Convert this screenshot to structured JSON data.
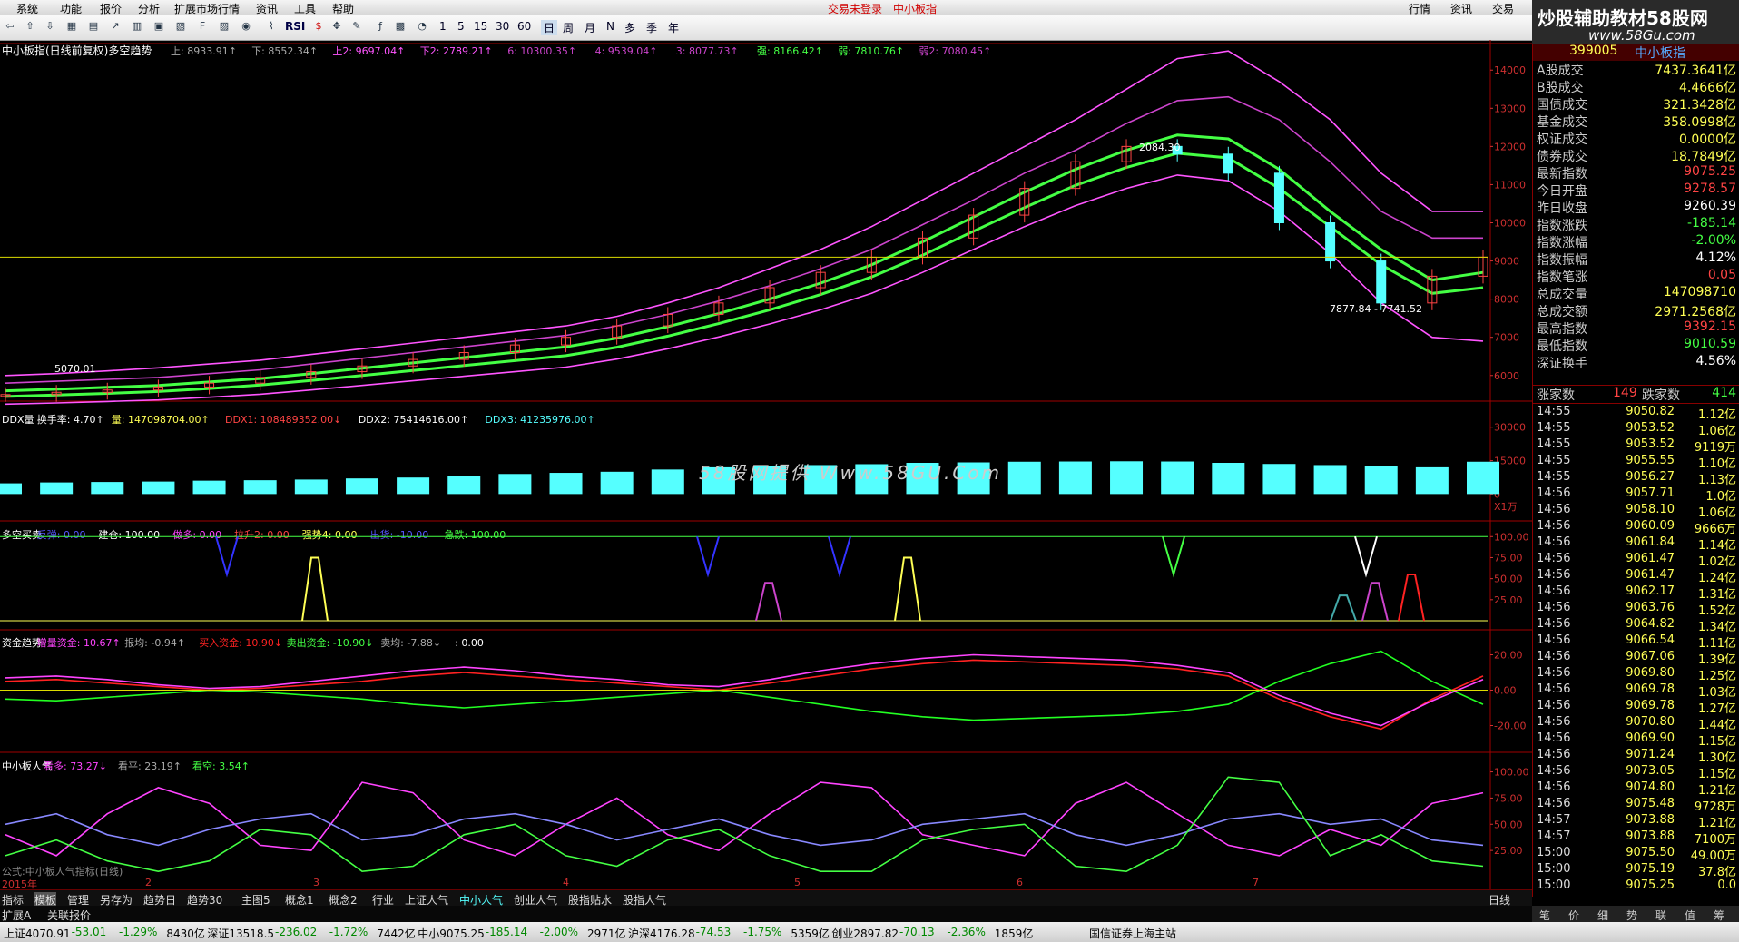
{
  "menu": {
    "items": [
      "系统",
      "功能",
      "报价",
      "分析",
      "扩展市场行情",
      "资讯",
      "工具",
      "帮助"
    ],
    "center": [
      "交易未登录",
      "中小板指"
    ],
    "right": [
      "行情",
      "资讯",
      "交易"
    ]
  },
  "toolbar": {
    "periods": [
      "1",
      "5",
      "15",
      "30",
      "60",
      "日",
      "周",
      "月",
      "N",
      "多",
      "季",
      "年"
    ],
    "rsi_label": "RSI"
  },
  "logo": {
    "line1": "炒股辅助教材58股网",
    "line2": "www.58Gu.com"
  },
  "watermark": "58股网提供 Www.58GU.Com",
  "main_panel": {
    "header_title": "中小板指(日线前复权)多空趋势",
    "header_fields": [
      {
        "text": "上: 8933.91↑",
        "color": "#aaaaaa"
      },
      {
        "text": "下: 8552.34↑",
        "color": "#aaaaaa"
      },
      {
        "text": "上2: 9697.04↑",
        "color": "#ff55ff"
      },
      {
        "text": "下2: 2789.21↑",
        "color": "#ff55ff"
      },
      {
        "text": "6: 10300.35↑",
        "color": "#cc44cc"
      },
      {
        "text": "4: 9539.04↑",
        "color": "#cc44cc"
      },
      {
        "text": "3: 8077.73↑",
        "color": "#cc44cc"
      },
      {
        "text": "强: 8166.42↑",
        "color": "#44ff44"
      },
      {
        "text": "弱: 7810.76↑",
        "color": "#44ff44"
      },
      {
        "text": "弱2: 7080.45↑",
        "color": "#cc44cc"
      }
    ],
    "annotations": {
      "high": "2084.30",
      "range": "7877.84 - 7741.52",
      "start": "5070.01"
    }
  },
  "chart_data": [
    {
      "type": "line",
      "title": "中小板指(日线前复权)多空趋势",
      "ylabel": "",
      "y_ticks": [
        14000,
        13000,
        12000,
        11000,
        10000,
        9000,
        8000,
        7000,
        6000
      ],
      "ylim": [
        5400,
        14600
      ],
      "x_labels": [
        "2015年",
        "2",
        "3",
        "4",
        "5",
        "6",
        "7"
      ],
      "series": [
        {
          "name": "上2",
          "color": "#ff55ff",
          "values": [
            6000,
            6050,
            6120,
            6200,
            6300,
            6400,
            6550,
            6700,
            6850,
            7000,
            7150,
            7300,
            7550,
            7900,
            8300,
            8800,
            9300,
            9900,
            10600,
            11300,
            12000,
            12700,
            13500,
            14300,
            14500,
            13700,
            12700,
            11300,
            10300,
            10300
          ]
        },
        {
          "name": "上",
          "color": "#cc44cc",
          "values": [
            5800,
            5850,
            5900,
            5950,
            6050,
            6150,
            6300,
            6450,
            6600,
            6750,
            6900,
            7050,
            7300,
            7600,
            7950,
            8350,
            8800,
            9300,
            9950,
            10600,
            11300,
            11900,
            12600,
            13200,
            13300,
            12700,
            11600,
            10300,
            9600,
            9600
          ]
        },
        {
          "name": "强",
          "color": "#44ff44",
          "values": [
            5600,
            5640,
            5690,
            5740,
            5830,
            5920,
            6050,
            6190,
            6330,
            6470,
            6610,
            6750,
            6980,
            7280,
            7620,
            8000,
            8420,
            8900,
            9500,
            10150,
            10800,
            11400,
            11900,
            12300,
            12200,
            11400,
            10300,
            9300,
            8500,
            8700
          ]
        },
        {
          "name": "弱",
          "color": "#44ff44",
          "values": [
            5450,
            5490,
            5530,
            5580,
            5660,
            5750,
            5870,
            6000,
            6130,
            6260,
            6390,
            6520,
            6740,
            7030,
            7360,
            7720,
            8120,
            8580,
            9150,
            9780,
            10400,
            10980,
            11450,
            11820,
            11700,
            10900,
            9900,
            8900,
            8150,
            8300
          ]
        },
        {
          "name": "下2",
          "color": "#ff55ff",
          "values": [
            5250,
            5280,
            5320,
            5360,
            5430,
            5510,
            5620,
            5740,
            5860,
            5980,
            6100,
            6220,
            6430,
            6700,
            7010,
            7350,
            7720,
            8150,
            8700,
            9300,
            9900,
            10450,
            10900,
            11250,
            11100,
            10300,
            9200,
            7900,
            7000,
            6900
          ]
        }
      ],
      "candles_close": [
        5500,
        5560,
        5620,
        5700,
        5800,
        5950,
        6100,
        6250,
        6420,
        6600,
        6800,
        7000,
        7300,
        7600,
        7900,
        8300,
        8700,
        9100,
        9600,
        10200,
        10900,
        11600,
        12000,
        11800,
        11300,
        10000,
        9000,
        7900,
        8600,
        9100
      ]
    },
    {
      "type": "bar",
      "title": "DDX量",
      "ylabel": "",
      "y_ticks": [
        30000,
        15000,
        0
      ],
      "ylim": [
        -8000,
        36000
      ],
      "series": [
        {
          "name": "量",
          "color": "#55ffff",
          "values": [
            4800,
            5200,
            5400,
            5600,
            6000,
            6200,
            6500,
            7000,
            7400,
            8000,
            9000,
            9500,
            10000,
            11000,
            12000,
            12500,
            13000,
            13400,
            14000,
            14200,
            14500,
            14600,
            14700,
            14600,
            14000,
            13500,
            13000,
            12500,
            12000,
            14500
          ]
        }
      ]
    },
    {
      "type": "line",
      "title": "多空买卖",
      "ylabel": "",
      "y_ticks": [
        100,
        75,
        50,
        25
      ],
      "ylim": [
        0,
        110
      ]
    },
    {
      "type": "line",
      "title": "资金趋势",
      "ylabel": "",
      "y_ticks": [
        20,
        0,
        -20
      ],
      "ylim": [
        -30,
        30
      ],
      "series": [
        {
          "name": "买入资金",
          "color": "#ff2222",
          "values": [
            5,
            6,
            4,
            2,
            0,
            1,
            3,
            5,
            8,
            10,
            8,
            6,
            4,
            2,
            0,
            4,
            8,
            12,
            15,
            17,
            16,
            15,
            14,
            12,
            8,
            -5,
            -15,
            -22,
            -5,
            8
          ]
        },
        {
          "name": "卖出资金",
          "color": "#22ff22",
          "values": [
            -5,
            -6,
            -4,
            -2,
            0,
            -1,
            -3,
            -5,
            -8,
            -10,
            -8,
            -6,
            -4,
            -2,
            0,
            -4,
            -8,
            -12,
            -15,
            -17,
            -16,
            -15,
            -14,
            -12,
            -8,
            5,
            15,
            22,
            5,
            -8
          ]
        },
        {
          "name": "增量资金",
          "color": "#ff44ff",
          "values": [
            7,
            8,
            6,
            3,
            1,
            2,
            5,
            8,
            11,
            13,
            11,
            8,
            6,
            3,
            2,
            6,
            11,
            15,
            18,
            20,
            19,
            18,
            17,
            14,
            10,
            -3,
            -13,
            -20,
            -6,
            6
          ]
        }
      ]
    },
    {
      "type": "line",
      "title": "中小板人气",
      "ylabel": "",
      "y_ticks": [
        100,
        75,
        50,
        25
      ],
      "ylim": [
        0,
        110
      ],
      "series": [
        {
          "name": "看多",
          "color": "#ff44ff",
          "values": [
            40,
            20,
            60,
            85,
            70,
            30,
            25,
            90,
            80,
            35,
            20,
            50,
            75,
            40,
            25,
            60,
            90,
            85,
            40,
            30,
            20,
            70,
            90,
            60,
            30,
            20,
            45,
            30,
            70,
            80
          ]
        },
        {
          "name": "看平",
          "color": "#8888ff",
          "values": [
            50,
            60,
            40,
            30,
            45,
            55,
            60,
            35,
            40,
            55,
            60,
            50,
            35,
            45,
            55,
            40,
            30,
            35,
            50,
            55,
            60,
            40,
            30,
            40,
            55,
            60,
            50,
            55,
            35,
            30
          ]
        },
        {
          "name": "看空",
          "color": "#44ff44",
          "values": [
            20,
            35,
            15,
            5,
            15,
            45,
            40,
            5,
            10,
            40,
            50,
            20,
            10,
            35,
            45,
            20,
            5,
            5,
            35,
            45,
            50,
            10,
            5,
            30,
            95,
            90,
            20,
            40,
            15,
            10
          ]
        }
      ]
    }
  ],
  "ddx_header": [
    {
      "text": "DDX量",
      "color": "#ffffff"
    },
    {
      "text": "换手率: 4.70↑",
      "color": "#ffffff"
    },
    {
      "text": "量: 147098704.00↑",
      "color": "#ffff55"
    },
    {
      "text": "DDX1: 108489352.00↓",
      "color": "#ff4444"
    },
    {
      "text": "DDX2: 75414616.00↑",
      "color": "#ffffff"
    },
    {
      "text": "DDX3: 41235976.00↑",
      "color": "#55ffff"
    }
  ],
  "duokong_header": [
    {
      "text": "多空买卖",
      "color": "#ffffff"
    },
    {
      "text": "反弹: 0.00",
      "color": "#5555ff"
    },
    {
      "text": "建仓: 100.00",
      "color": "#ffffff"
    },
    {
      "text": "做多: 0.00",
      "color": "#ff44ff"
    },
    {
      "text": "拉升2: 0.00",
      "color": "#ff4444"
    },
    {
      "text": "强势4: 0.00",
      "color": "#ffff55"
    },
    {
      "text": "出货: -10.00",
      "color": "#5555ff"
    },
    {
      "text": "急跌: 100.00",
      "color": "#44ff44"
    }
  ],
  "fund_header": [
    {
      "text": "资金趋势",
      "color": "#ffffff"
    },
    {
      "text": "增量资金: 10.67↑",
      "color": "#ff44ff"
    },
    {
      "text": "报均: -0.94↑",
      "color": "#aaaaaa"
    },
    {
      "text": "买入资金: 10.90↓",
      "color": "#ff2222"
    },
    {
      "text": "卖出资金: -10.90↓",
      "color": "#44ff44"
    },
    {
      "text": "卖均: -7.88↓",
      "color": "#aaaaaa"
    },
    {
      "text": ": 0.00",
      "color": "#ffffff"
    }
  ],
  "renqi_header": [
    {
      "text": "中小板人气",
      "color": "#ffffff"
    },
    {
      "text": "看多: 73.27↓",
      "color": "#ff44ff"
    },
    {
      "text": "看平: 23.19↑",
      "color": "#aaaaaa"
    },
    {
      "text": "看空: 3.54↑",
      "color": "#44ff44"
    }
  ],
  "renqi_note": "公式:中小板人气指标(日线)",
  "unit_label": "X1万",
  "timeline": {
    "labels": [
      "2015年",
      "2",
      "3",
      "4",
      "5",
      "6",
      "7"
    ]
  },
  "tabs": [
    "指标",
    "模板",
    "管理",
    "另存为",
    "趋势日",
    "趋势30",
    "主图5",
    "概念1",
    "概念2",
    "行业",
    "上证人气",
    "中小人气",
    "创业人气",
    "股指贴水",
    "股指人气"
  ],
  "tabs2": [
    "扩展A",
    "关联报价"
  ],
  "period_label": "日线",
  "side": {
    "code": "399005",
    "name": "中小板指",
    "rows": [
      {
        "label": "A股成交",
        "value": "7437.3641亿",
        "color": "#ffff55"
      },
      {
        "label": "B股成交",
        "value": "4.4666亿",
        "color": "#ffff55"
      },
      {
        "label": "国债成交",
        "value": "321.3428亿",
        "color": "#ffff55"
      },
      {
        "label": "基金成交",
        "value": "358.0998亿",
        "color": "#ffff55"
      },
      {
        "label": "权证成交",
        "value": "0.0000亿",
        "color": "#ffff55"
      },
      {
        "label": "债券成交",
        "value": "18.7849亿",
        "color": "#ffff55"
      },
      {
        "label": "最新指数",
        "value": "9075.25",
        "color": "#ff4444"
      },
      {
        "label": "今日开盘",
        "value": "9278.57",
        "color": "#ff4444"
      },
      {
        "label": "昨日收盘",
        "value": "9260.39",
        "color": "#ffffff"
      },
      {
        "label": "指数涨跌",
        "value": "-185.14",
        "color": "#44ff44"
      },
      {
        "label": "指数涨幅",
        "value": "-2.00%",
        "color": "#44ff44"
      },
      {
        "label": "指数振幅",
        "value": "4.12%",
        "color": "#ffffff"
      },
      {
        "label": "指数笔涨",
        "value": "0.05",
        "color": "#ff4444"
      },
      {
        "label": "总成交量",
        "value": "147098710",
        "color": "#ffff55"
      },
      {
        "label": "总成交额",
        "value": "2971.2568亿",
        "color": "#ffff55"
      },
      {
        "label": "最高指数",
        "value": "9392.15",
        "color": "#ff4444"
      },
      {
        "label": "最低指数",
        "value": "9010.59",
        "color": "#44ff44"
      },
      {
        "label": "深证换手",
        "value": "4.56%",
        "color": "#ffffff"
      }
    ],
    "up_label": "涨家数",
    "up_value": "149",
    "down_label": "跌家数",
    "down_value": "414",
    "ticks": [
      {
        "t": "14:55",
        "p": "9050.82",
        "v": "1.12亿"
      },
      {
        "t": "14:55",
        "p": "9053.52",
        "v": "1.06亿"
      },
      {
        "t": "14:55",
        "p": "9053.52",
        "v": "9119万"
      },
      {
        "t": "14:55",
        "p": "9055.55",
        "v": "1.10亿"
      },
      {
        "t": "14:55",
        "p": "9056.27",
        "v": "1.13亿"
      },
      {
        "t": "14:56",
        "p": "9057.71",
        "v": "1.0亿"
      },
      {
        "t": "14:56",
        "p": "9058.10",
        "v": "1.06亿"
      },
      {
        "t": "14:56",
        "p": "9060.09",
        "v": "9666万"
      },
      {
        "t": "14:56",
        "p": "9061.84",
        "v": "1.14亿"
      },
      {
        "t": "14:56",
        "p": "9061.47",
        "v": "1.02亿"
      },
      {
        "t": "14:56",
        "p": "9061.47",
        "v": "1.24亿"
      },
      {
        "t": "14:56",
        "p": "9062.17",
        "v": "1.31亿"
      },
      {
        "t": "14:56",
        "p": "9063.76",
        "v": "1.52亿"
      },
      {
        "t": "14:56",
        "p": "9064.82",
        "v": "1.34亿"
      },
      {
        "t": "14:56",
        "p": "9066.54",
        "v": "1.11亿"
      },
      {
        "t": "14:56",
        "p": "9067.06",
        "v": "1.39亿"
      },
      {
        "t": "14:56",
        "p": "9069.80",
        "v": "1.25亿"
      },
      {
        "t": "14:56",
        "p": "9069.78",
        "v": "1.03亿"
      },
      {
        "t": "14:56",
        "p": "9069.78",
        "v": "1.27亿"
      },
      {
        "t": "14:56",
        "p": "9070.80",
        "v": "1.44亿"
      },
      {
        "t": "14:56",
        "p": "9069.90",
        "v": "1.15亿"
      },
      {
        "t": "14:56",
        "p": "9071.24",
        "v": "1.30亿"
      },
      {
        "t": "14:56",
        "p": "9073.05",
        "v": "1.15亿"
      },
      {
        "t": "14:56",
        "p": "9074.80",
        "v": "1.21亿"
      },
      {
        "t": "14:56",
        "p": "9075.48",
        "v": "9728万"
      },
      {
        "t": "14:57",
        "p": "9073.88",
        "v": "1.21亿"
      },
      {
        "t": "14:57",
        "p": "9073.88",
        "v": "7100万"
      },
      {
        "t": "15:00",
        "p": "9075.50",
        "v": "49.00万"
      },
      {
        "t": "15:00",
        "p": "9075.19",
        "v": "37.8亿"
      },
      {
        "t": "15:00",
        "p": "9075.25",
        "v": "0.0"
      }
    ],
    "bottom_tabs": [
      "笔",
      "价",
      "细",
      "势",
      "联",
      "值",
      "筹"
    ]
  },
  "statusbar": {
    "segments": [
      {
        "text": "上证4070.91",
        "color": "#000000"
      },
      {
        "text": "-53.01",
        "color": "#008800"
      },
      {
        "text": "-1.29%",
        "color": "#008800"
      },
      {
        "text": "8430亿",
        "color": "#000000"
      },
      {
        "text": "深证13518.5",
        "color": "#000000"
      },
      {
        "text": "-236.02",
        "color": "#008800"
      },
      {
        "text": "-1.72%",
        "color": "#008800"
      },
      {
        "text": "7442亿",
        "color": "#000000"
      },
      {
        "text": "中小9075.25",
        "color": "#000000"
      },
      {
        "text": "-185.14",
        "color": "#008800"
      },
      {
        "text": "-2.00%",
        "color": "#008800"
      },
      {
        "text": "2971亿",
        "color": "#000000"
      },
      {
        "text": "沪深4176.28",
        "color": "#000000"
      },
      {
        "text": "-74.53",
        "color": "#008800"
      },
      {
        "text": "-1.75%",
        "color": "#008800"
      },
      {
        "text": "5359亿",
        "color": "#000000"
      },
      {
        "text": "创业2897.82",
        "color": "#000000"
      },
      {
        "text": "-70.13",
        "color": "#008800"
      },
      {
        "text": "-2.36%",
        "color": "#008800"
      },
      {
        "text": "1859亿",
        "color": "#000000"
      }
    ],
    "server": "国信证券上海主站"
  }
}
